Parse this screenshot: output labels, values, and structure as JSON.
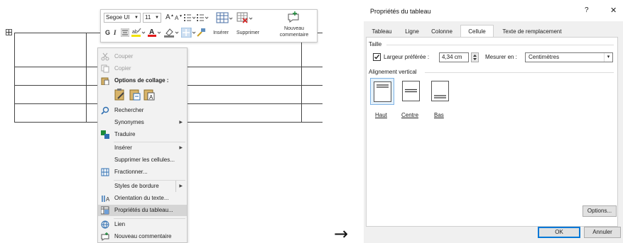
{
  "mini_toolbar": {
    "font_name": "Segoe UI",
    "font_size": "11",
    "grow_font": "A",
    "shrink_font": "A",
    "bold": "G",
    "italic": "I",
    "insert_label": "Insérer",
    "delete_label": "Supprimer",
    "comment_label_line1": "Nouveau",
    "comment_label_line2": "commentaire",
    "colors": {
      "highlight": "#f2e200",
      "font_color": "#e01b1b",
      "shading": "#7a7a7a"
    }
  },
  "context_menu": {
    "items": [
      {
        "label": "Couper",
        "disabled": true
      },
      {
        "label": "Copier",
        "disabled": true
      },
      {
        "label": "Options de collage :",
        "bold": true
      },
      {
        "label": "Rechercher"
      },
      {
        "label": "Synonymes",
        "submenu": true
      },
      {
        "label": "Traduire"
      },
      {
        "label": "Insérer",
        "submenu": true
      },
      {
        "label": "Supprimer les cellules..."
      },
      {
        "label": "Fractionner..."
      },
      {
        "label": "Styles de bordure",
        "submenu": true
      },
      {
        "label": "Orientation du texte..."
      },
      {
        "label": "Propriétés du tableau...",
        "highlighted": true
      },
      {
        "label": "Lien"
      },
      {
        "label": "Nouveau commentaire"
      }
    ]
  },
  "arrow": "→",
  "dialog": {
    "title": "Propriétés du tableau",
    "help": "?",
    "close": "✕",
    "tabs": [
      "Tableau",
      "Ligne",
      "Colonne",
      "Cellule",
      "Texte de remplacement"
    ],
    "active_tab": "Cellule",
    "size_group": "Taille",
    "preferred_width_label": "Largeur préférée :",
    "preferred_width_checked": true,
    "preferred_width_value": "4,34 cm",
    "measure_label": "Mesurer en :",
    "measure_value": "Centimètres",
    "valign_group": "Alignement vertical",
    "valign_options": [
      "Haut",
      "Centre",
      "Bas"
    ],
    "valign_selected": "Haut",
    "options_button": "Options...",
    "ok_button": "OK",
    "cancel_button": "Annuler"
  }
}
